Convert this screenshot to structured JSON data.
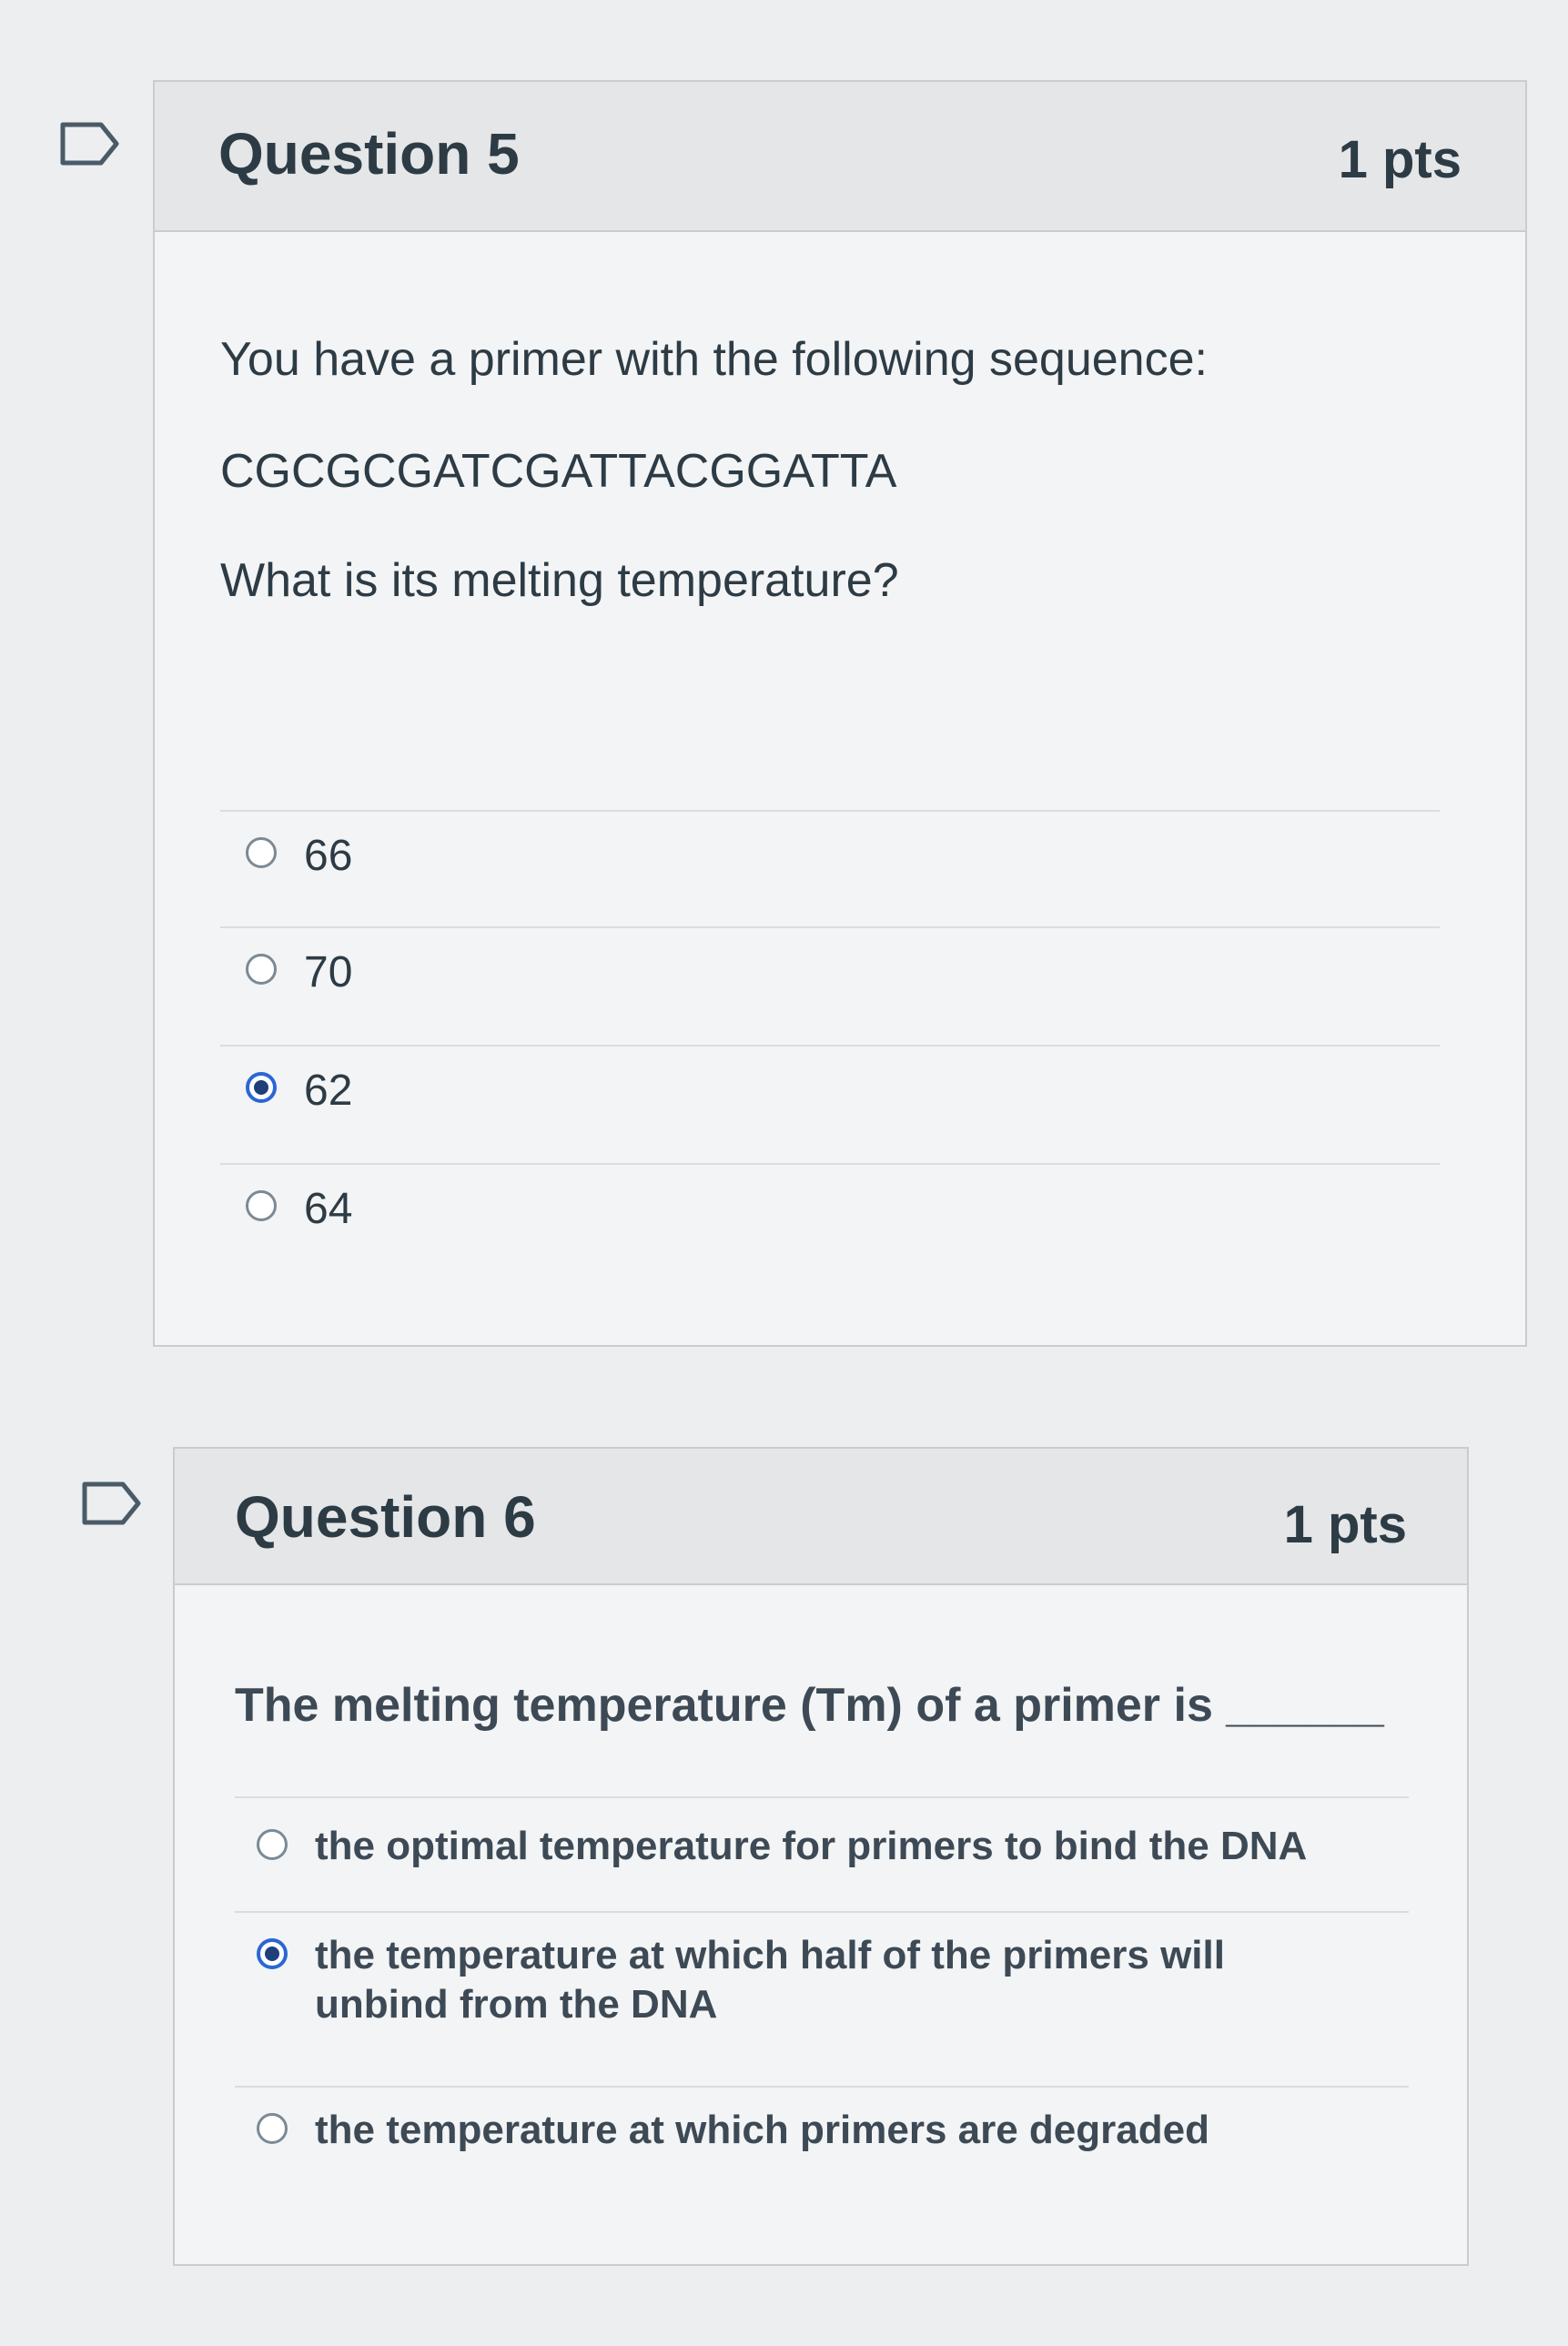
{
  "questions": [
    {
      "title": "Question 5",
      "points": "1 pts",
      "prompt_lines": [
        "You have a primer with the following sequence:",
        "CGCGCGATCGATTACGGATTA",
        "What is its melting temperature?"
      ],
      "answers": [
        {
          "label": "66",
          "selected": false
        },
        {
          "label": "70",
          "selected": false
        },
        {
          "label": "62",
          "selected": true
        },
        {
          "label": "64",
          "selected": false
        }
      ]
    },
    {
      "title": "Question 6",
      "points": "1 pts",
      "prompt_lines": [
        "The melting temperature (Tm) of a primer is ______"
      ],
      "answers": [
        {
          "label": "the optimal temperature for primers to bind the DNA",
          "selected": false
        },
        {
          "label": "the temperature at which half of the primers will unbind from the DNA",
          "selected": true
        },
        {
          "label": "the temperature at which primers are degraded",
          "selected": false
        }
      ]
    }
  ],
  "colors": {
    "accent": "#2b66d6",
    "header_bg": "#e4e6e8",
    "text": "#2d3b45"
  },
  "icons": {
    "flag": "bookmark-flag-icon"
  }
}
